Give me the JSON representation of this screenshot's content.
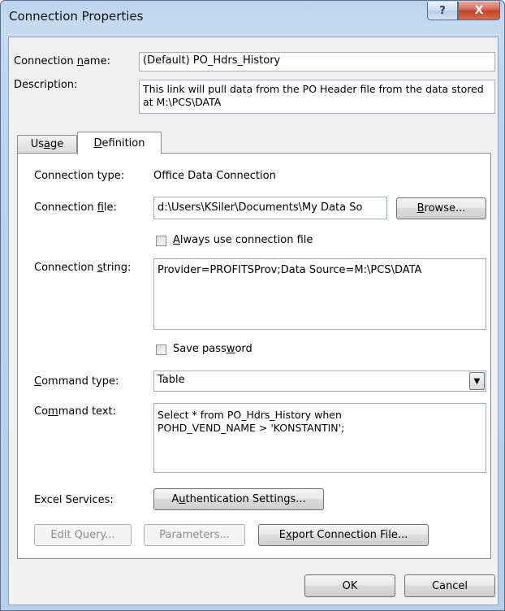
{
  "window": {
    "title": "Connection Properties",
    "help_glyph": "?",
    "close_glyph": "X"
  },
  "general": {
    "name_label": "Connection name:",
    "name_value": "(Default) PO_Hdrs_History",
    "description_label": "Description:",
    "description_value": "This link will pull data from the PO Header file from the data stored at M:\\PCS\\DATA"
  },
  "tabs": [
    {
      "label": "Usage",
      "active": false
    },
    {
      "label": "Definition",
      "active": true
    }
  ],
  "definition": {
    "type_label": "Connection type:",
    "type_value": "Office Data Connection",
    "file_label": "Connection file:",
    "file_value": "d:\\Users\\KSiler\\Documents\\My Data So",
    "browse_label": "Browse...",
    "always_use_label": "Always use connection file",
    "always_use_checked": false,
    "string_label": "Connection string:",
    "string_value": "Provider=PROFITSProv;Data Source=M:\\PCS\\DATA",
    "save_password_label": "Save password",
    "save_password_checked": false,
    "command_type_label": "Command type:",
    "command_type_value": "Table",
    "command_text_label": "Command text:",
    "command_text_value": "Select * from PO_Hdrs_History when\nPOHD_VEND_NAME > 'KONSTANTIN';",
    "excel_services_label": "Excel Services:",
    "auth_settings_label": "Authentication Settings...",
    "edit_query_label": "Edit Query...",
    "parameters_label": "Parameters...",
    "export_label": "Export Connection File..."
  },
  "footer": {
    "ok_label": "OK",
    "cancel_label": "Cancel"
  }
}
